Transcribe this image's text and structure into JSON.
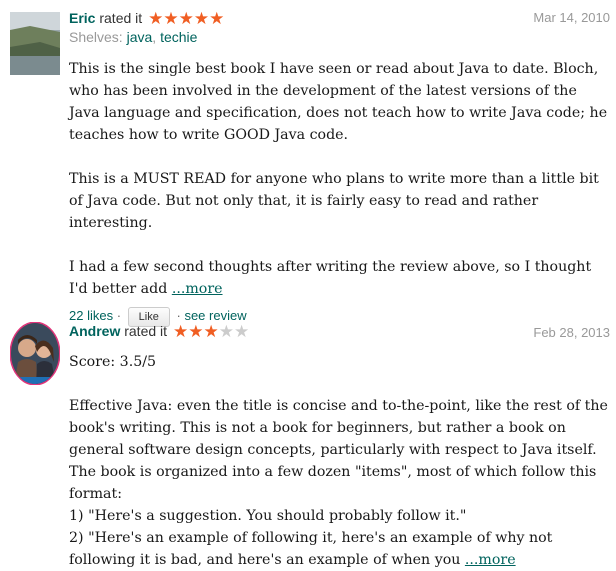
{
  "reviews": [
    {
      "user": "Eric",
      "rated_text": "rated it",
      "stars_filled": 5,
      "stars_total": 5,
      "date": "Mar 14, 2010",
      "shelves_label": "Shelves:",
      "shelves": [
        "java",
        "techie"
      ],
      "paragraphs": [
        "This is the single best book I have seen or read about Java to date. Bloch, who has been involved in the development of the latest versions of the Java language and specification, does not teach how to write Java code; he teaches how to write GOOD Java code.",
        "This is a MUST READ for anyone who plans to write more than a little bit of Java code. But not only that, it is fairly easy to read and rather interesting."
      ],
      "last_paragraph": "I had a few second thoughts after writing the review above, so I thought I'd better add",
      "more_label": "...more",
      "likes": "22 likes",
      "like_button": "Like",
      "see_review": "see review"
    },
    {
      "user": "Andrew",
      "rated_text": "rated it",
      "stars_filled": 3,
      "stars_total": 5,
      "date": "Feb 28, 2013",
      "paragraphs": [
        "Score: 3.5/5"
      ],
      "last_paragraph_lines": [
        "Effective Java: even the title is concise and to-the-point, like the rest of the book's writing. This is not a book for beginners, but rather a book on general software design concepts, particularly with respect to Java itself. The book is organized into a few dozen \"items\", most of which follow this format:",
        "1) \"Here's a suggestion. You should probably follow it.\"",
        "2) \"Here's an example of following it, here's an example of why not following it is bad, and here's an example of when you"
      ],
      "more_label": "...more"
    }
  ],
  "colors": {
    "accent": "#00635d",
    "star": "#f05e23"
  }
}
